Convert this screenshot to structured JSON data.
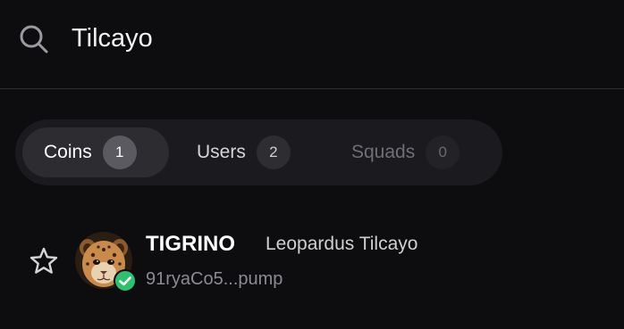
{
  "search": {
    "value": "Tilcayo",
    "icon": "search-icon"
  },
  "tabs": [
    {
      "label": "Coins",
      "count": "1",
      "state": "active"
    },
    {
      "label": "Users",
      "count": "2",
      "state": "inactive"
    },
    {
      "label": "Squads",
      "count": "0",
      "state": "disabled"
    }
  ],
  "results": [
    {
      "symbol": "TIGRINO",
      "name": "Leopardus Tilcayo",
      "address": "91ryaCo5...pump",
      "favorite_icon": "star-outline-icon",
      "avatar": "cub-avatar",
      "verified": true,
      "verified_color": "#2fbf71"
    }
  ],
  "colors": {
    "background": "#0d0d0f",
    "tab_bar": "#1b1b1f",
    "active_tab": "#2c2c31",
    "divider": "#2c2c30"
  }
}
